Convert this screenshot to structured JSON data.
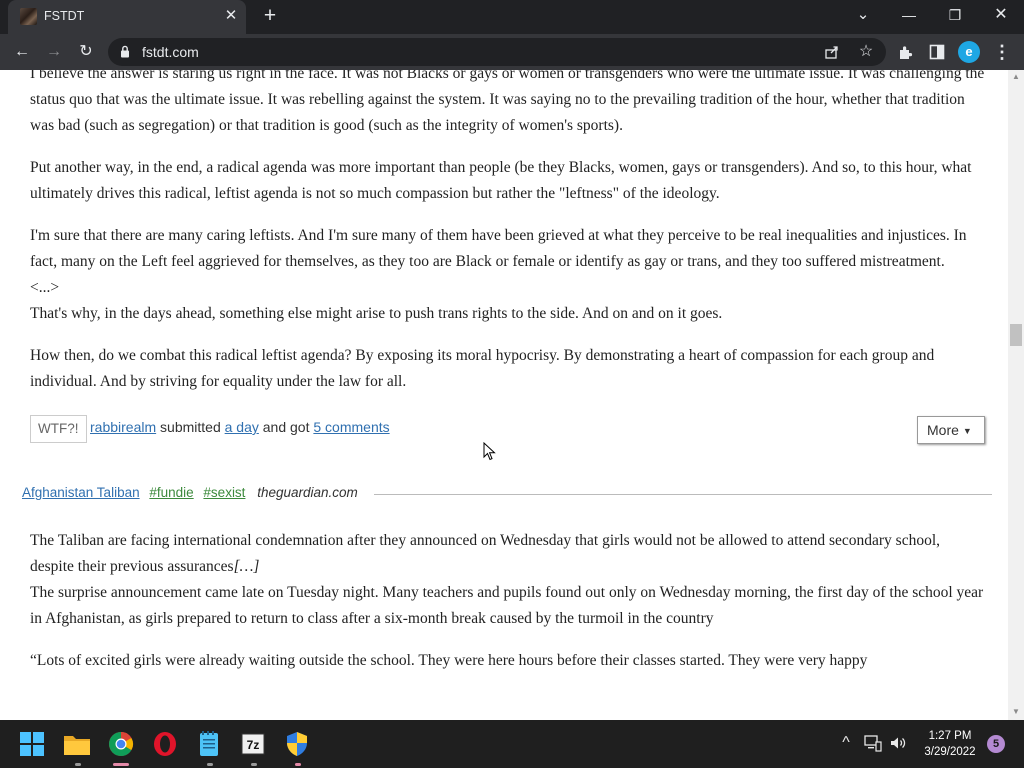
{
  "tab": {
    "title": "FSTDT",
    "close": "✕",
    "new_tab": "+"
  },
  "window_controls": {
    "tab_search": "⌄",
    "minimize": "—",
    "restore": "❐",
    "close": "✕"
  },
  "toolbar": {
    "back": "←",
    "forward": "→",
    "reload": "↻",
    "url": "fstdt.com",
    "profile_initial": "e"
  },
  "post1": {
    "paragraphs": [
      "I believe the answer is staring us right in the face. It was not Blacks or gays or women or transgenders who were the ultimate issue. It was challenging the status quo that was the ultimate issue. It was rebelling against the system. It was saying no to the prevailing tradition of the hour, whether that tradition was bad (such as segregation) or that tradition is good (such as the integrity of women's sports).",
      "Put another way, in the end, a radical agenda was more important than people (be they Blacks, women, gays or transgenders). And so, to this hour, what ultimately drives this radical, leftist agenda is not so much compassion but rather the \"leftness\" of the ideology.",
      "I'm sure that there are many caring leftists. And I'm sure many of them have been grieved at what they perceive to be real inequalities and injustices. In fact, many on the Left feel aggrieved for themselves, as they too are Black or female or identify as gay or trans, and they too suffered mistreatment.",
      "<...>",
      "That's why, in the days ahead, something else might arise to push trans rights to the side. And on and on it goes.",
      "How then, do we combat this radical leftist agenda? By exposing its moral hypocrisy. By demonstrating a heart of compassion for each group and individual. And by striving for equality under the law for all."
    ],
    "wtf_button": "WTF?!",
    "author": "rabbirealm",
    "submitted_text": "submitted",
    "time": "a day",
    "and_got": "and got",
    "comments": "5 comments",
    "more_button": "More",
    "more_caret": "▼"
  },
  "post2": {
    "category": "Afghanistan Taliban",
    "tags": [
      "#fundie",
      "#sexist"
    ],
    "source": "theguardian.com",
    "paragraph1": "The Taliban are facing international condemnation after they announced on Wednesday that girls would not be allowed to attend secondary school, despite their previous assurances",
    "ellipsis": "[…]",
    "paragraph2": "The surprise announcement came late on Tuesday night. Many teachers and pupils found out only on Wednesday morning, the first day of the school year in Afghanistan, as girls prepared to return to class after a six-month break caused by the turmoil in the country",
    "paragraph3": "“Lots of excited girls were already waiting outside the school. They were here hours before their classes started. They were very happy"
  },
  "taskbar": {
    "time": "1:27 PM",
    "date": "3/29/2022",
    "notification_count": "5",
    "apps": [
      "start-menu",
      "file-explorer",
      "chrome",
      "opera",
      "notepad",
      "7zip",
      "security-center"
    ]
  },
  "colors": {
    "link": "#3070b0",
    "tag": "#3c8a3c",
    "chrome_dark": "#202124",
    "chrome_toolbar": "#35363a"
  }
}
